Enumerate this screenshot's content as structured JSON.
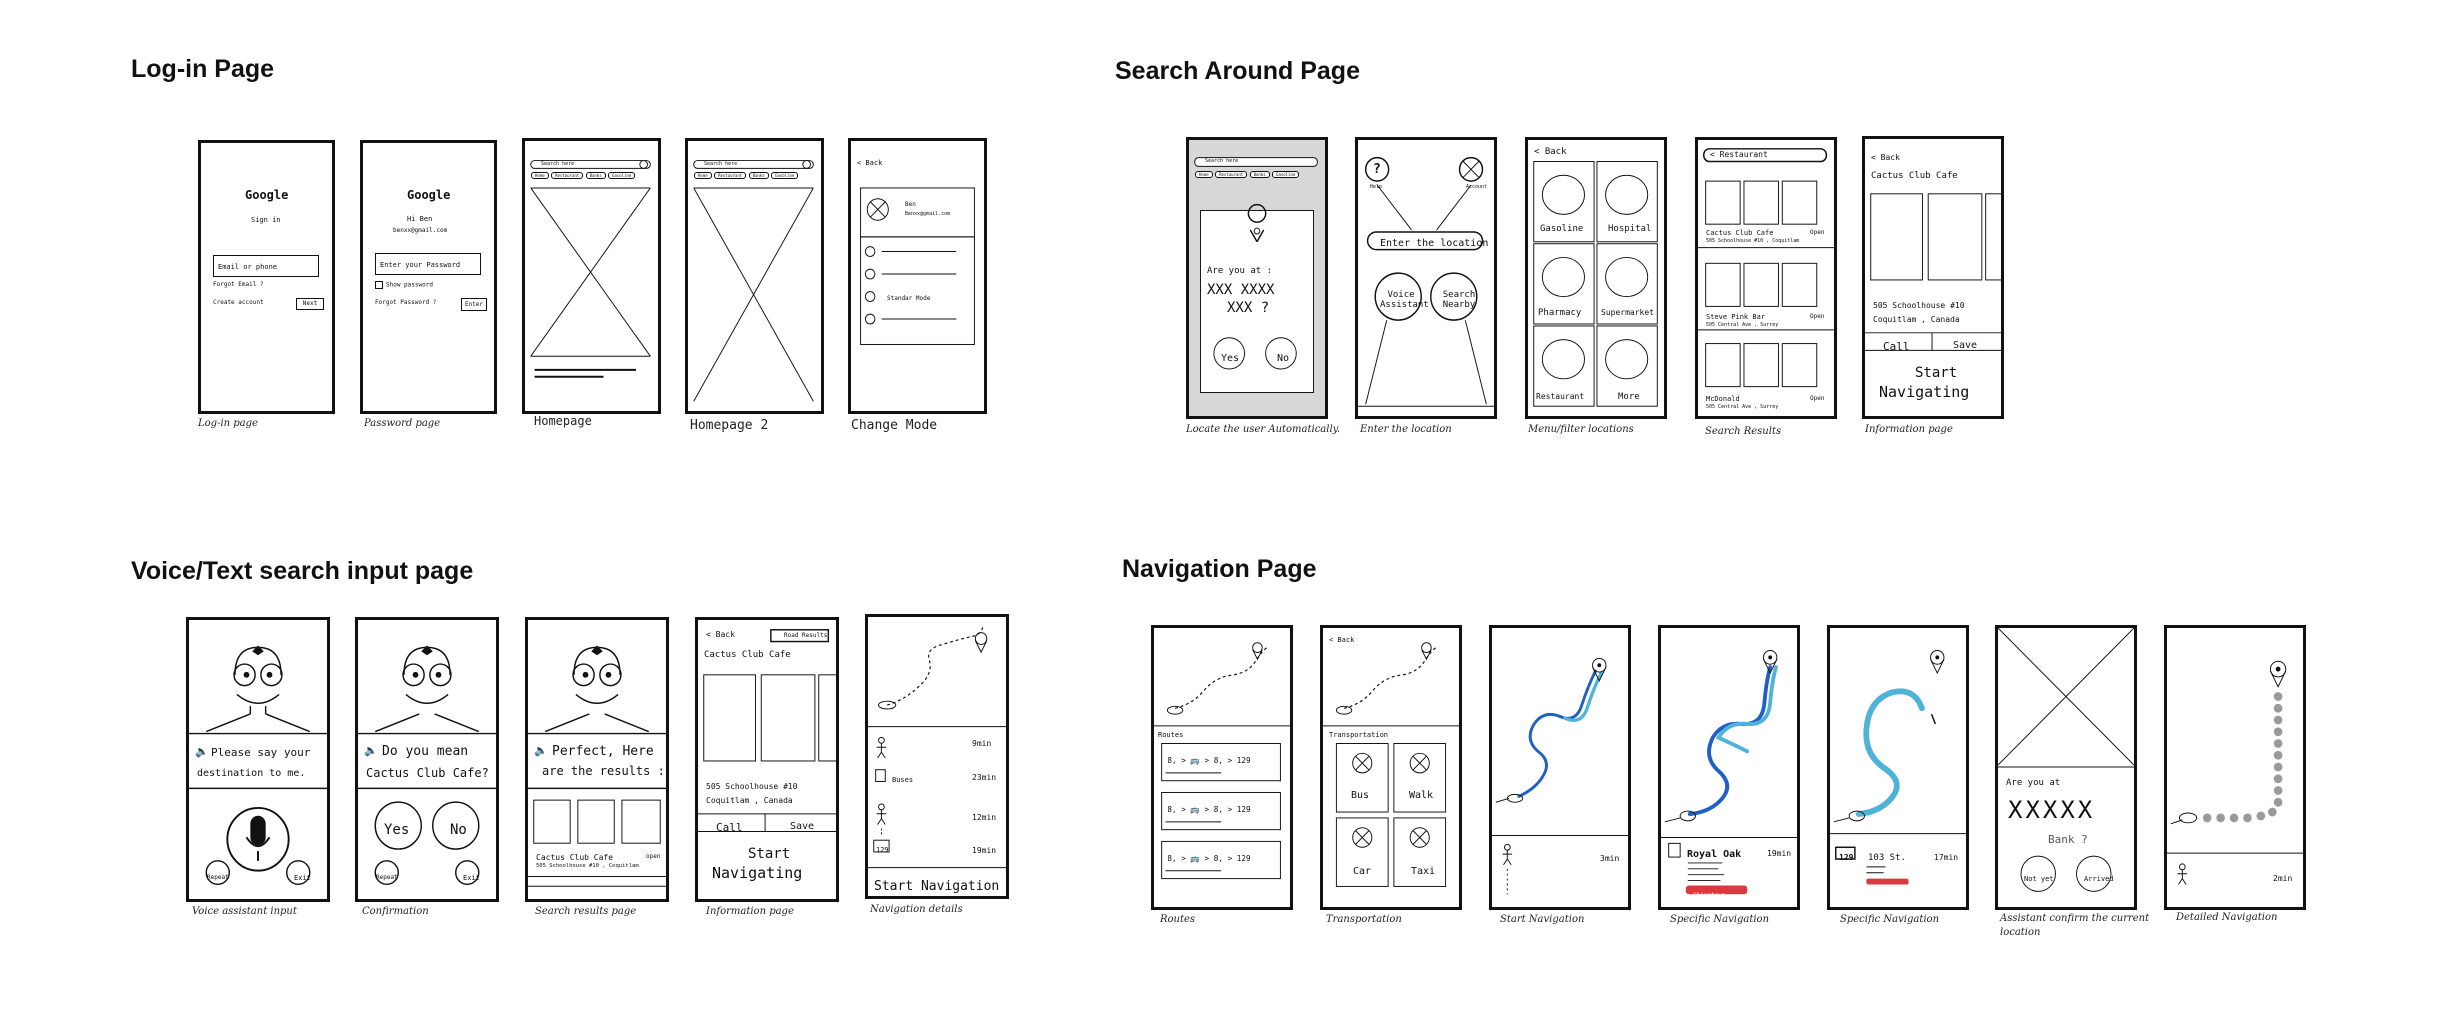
{
  "sections": {
    "login": {
      "title": "Log-in Page"
    },
    "search": {
      "title": "Search Around Page"
    },
    "voice": {
      "title": "Voice/Text search input page"
    },
    "nav": {
      "title": "Navigation Page"
    }
  },
  "login_frames": {
    "f1": {
      "caption": "Log-in page",
      "logo": "Google",
      "subtitle": "Sign in",
      "field": "Email or phone",
      "forgot": "Forgot Email ?",
      "create": "Create account",
      "next": "Next"
    },
    "f2": {
      "caption": "Password page",
      "logo": "Google",
      "greeting": "Hi Ben",
      "email": "benxx@gmail.com",
      "field": "Enter your Password",
      "show": "Show password",
      "forgot": "Forgot Password ?",
      "enter": "Enter"
    },
    "f3": {
      "caption": "Homepage",
      "search": "Search here",
      "chips": [
        "Home",
        "Restaurant",
        "Banks",
        "Gasoline"
      ]
    },
    "f4": {
      "caption": "Homepage 2",
      "search": "Search here",
      "chips": [
        "Home",
        "Restaurant",
        "Banks",
        "Gasoline"
      ]
    },
    "f5": {
      "caption": "Change Mode",
      "back": "< Back",
      "name": "Ben",
      "email": "Benxx@gmail.com",
      "mode": "Standar Mode"
    }
  },
  "search_frames": {
    "f1": {
      "caption": "Locate the user Automatically.",
      "search": "Search here",
      "chips": [
        "Home",
        "Restaurant",
        "Banks",
        "Gasoline"
      ],
      "question": "Are you at :",
      "placeholder1": "XXX XXXX",
      "placeholder2": "XXX ?",
      "yes": "Yes",
      "no": "No"
    },
    "f2": {
      "caption": "Enter the location",
      "help": "Help",
      "account": "Account",
      "enter": "Enter the location",
      "voice": "Voice Assistant",
      "nearby": "Search Nearby"
    },
    "f3": {
      "caption": "Menu/filter locations",
      "back": "< Back",
      "cells": [
        "Gasoline",
        "Hospital",
        "Pharmacy",
        "Supermarket",
        "Restaurant",
        "More"
      ]
    },
    "f4": {
      "caption": "Search Results",
      "pill": "< Restaurant",
      "r1": "Cactus Club Cafe",
      "r1a": "505 Schoolhouse #10 , Coquitlam",
      "r2": "Steve Pink Bar",
      "r2a": "505 Central Ave , Surrey",
      "r3": "McDonald",
      "r3a": "505 Central Ave , Surrey",
      "open": "Open"
    },
    "f5": {
      "caption": "Information page",
      "back": "< Back",
      "name": "Cactus Club Cafe",
      "addr1": "505 Schoolhouse #10",
      "addr2": "Coquitlam , Canada",
      "call": "Call",
      "save": "Save",
      "start1": "Start",
      "start2": "Navigating"
    }
  },
  "voice_frames": {
    "f1": {
      "caption": "Voice assistant input",
      "msg1": "Please say your",
      "msg2": "destination to me.",
      "repeat": "Repeat",
      "exit": "Exit"
    },
    "f2": {
      "caption": "Confirmation",
      "msg1": "Do you mean",
      "msg2": "Cactus Club Cafe?",
      "yes": "Yes",
      "no": "No",
      "repeat": "Repeat",
      "exit": "Exit"
    },
    "f3": {
      "caption": "Search results page",
      "msg1": "Perfect, Here",
      "msg2": "are the results :",
      "r1": "Cactus Club Cafe",
      "r1a": "505 Schoolhouse #10 , Coquitlam",
      "open": "open"
    },
    "f4": {
      "caption": "Information page",
      "back": "< Back",
      "road": "Road Results",
      "name": "Cactus Club Cafe",
      "addr1": "505 Schoolhouse #10",
      "addr2": "Coquitlam , Canada",
      "call": "Call",
      "save": "Save",
      "start1": "Start",
      "start2": "Navigating"
    },
    "f5": {
      "caption": "Navigation details",
      "t1": "9min",
      "buses": "Buses",
      "t2": "23min",
      "t3": "12min",
      "t4": "19min",
      "start": "Start Navigation"
    }
  },
  "nav_frames": {
    "f1": {
      "caption": "Routes",
      "routes": "Routes"
    },
    "f2": {
      "caption": "Transportation",
      "back": "< Back",
      "title": "Transportation",
      "modes": [
        "Bus",
        "Walk",
        "Car",
        "Taxi"
      ]
    },
    "f3": {
      "caption": "Start Navigation",
      "time": "3min"
    },
    "f4": {
      "caption": "Specific Navigation",
      "stop": "Royal Oak",
      "time": "19min",
      "tag": "Chinatown"
    },
    "f5": {
      "caption": "Specific Navigation",
      "bus": "129",
      "stop": "103 St.",
      "time": "17min"
    },
    "f6": {
      "caption": "Assistant confirm the current location",
      "question": "Are you at",
      "mask": "XXXXX",
      "bank": "Bank ?",
      "notyet": "Not yet",
      "arrived": "Arrived"
    },
    "f7": {
      "caption": "Detailed Navigation",
      "time": "2min"
    }
  },
  "colors": {
    "ink": "#111111",
    "route_light": "#4fb3d9",
    "route_dark": "#1f5fc7",
    "tag": "#d9393f",
    "dots": "#9a9a9a",
    "gray_frame": "#d7d7d7"
  }
}
